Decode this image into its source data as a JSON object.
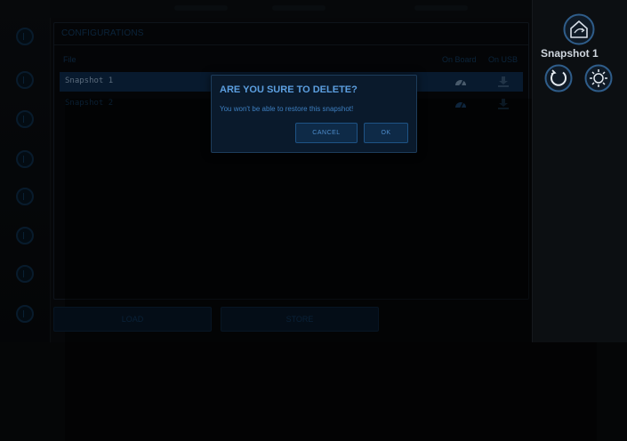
{
  "panel": {
    "title": "CONFIGURATIONS",
    "columns": {
      "file": "File",
      "on_board": "On Board",
      "on_usb": "On USB"
    },
    "rows": [
      {
        "name": "Snapshot 1"
      },
      {
        "name": "Snapshot 2"
      }
    ]
  },
  "buttons": {
    "load": "LOAD",
    "store": "STORE"
  },
  "right": {
    "snapshot_title": "Snapshot 1"
  },
  "dialog": {
    "title": "ARE YOU SURE TO DELETE?",
    "message": "You won't be able to restore this snapshot!",
    "cancel": "CANCEL",
    "ok": "OK"
  },
  "colors": {
    "accent": "#5c9fe0",
    "selection": "#0d2948",
    "background": "#0a0c0e"
  },
  "icons": [
    "home-icon",
    "refresh-icon",
    "brightness-icon",
    "gauge-icon",
    "download-icon"
  ]
}
